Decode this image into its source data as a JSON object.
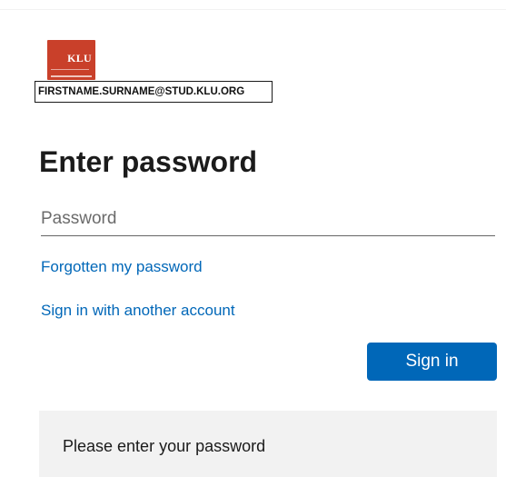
{
  "logo": {
    "text": "KLU",
    "color": "#c9402a"
  },
  "identity": {
    "account": "FIRSTNAME.SURNAME@STUD.KLU.ORG"
  },
  "page": {
    "title": "Enter password"
  },
  "password": {
    "placeholder": "Password",
    "value": ""
  },
  "links": {
    "forgot": "Forgotten my password",
    "other_account": "Sign in with another account"
  },
  "actions": {
    "sign_in": "Sign in"
  },
  "message": {
    "text": "Please enter your password"
  },
  "colors": {
    "accent": "#0067b8",
    "message_bg": "#f2f2f2"
  }
}
